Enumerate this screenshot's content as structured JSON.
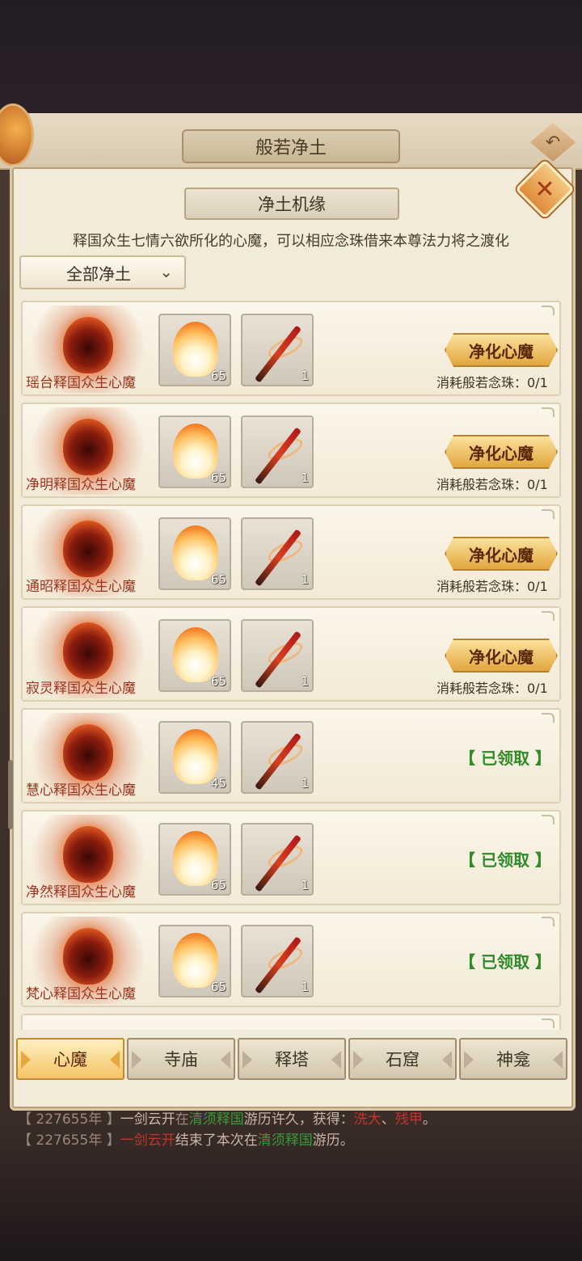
{
  "header": {
    "title": "般若净土"
  },
  "panel": {
    "title": "净土机缘",
    "description": "释国众生七情六欲所化的心魔，可以相应念珠借来本尊法力将之渡化",
    "filter": {
      "selected": "全部净土"
    }
  },
  "rows": [
    {
      "name": "瑶台释国众生心魔",
      "fire_qty": "65",
      "brush_qty": "1",
      "status": "action",
      "button": "净化心魔",
      "cost": "消耗般若念珠：0/1"
    },
    {
      "name": "净明释国众生心魔",
      "fire_qty": "65",
      "brush_qty": "1",
      "status": "action",
      "button": "净化心魔",
      "cost": "消耗般若念珠：0/1"
    },
    {
      "name": "通昭释国众生心魔",
      "fire_qty": "65",
      "brush_qty": "1",
      "status": "action",
      "button": "净化心魔",
      "cost": "消耗般若念珠：0/1"
    },
    {
      "name": "寂灵释国众生心魔",
      "fire_qty": "65",
      "brush_qty": "1",
      "status": "action",
      "button": "净化心魔",
      "cost": "消耗般若念珠：0/1"
    },
    {
      "name": "慧心释国众生心魔",
      "fire_qty": "45",
      "brush_qty": "1",
      "status": "claimed",
      "claimed": "【 已领取 】"
    },
    {
      "name": "净然释国众生心魔",
      "fire_qty": "65",
      "brush_qty": "1",
      "status": "claimed",
      "claimed": "【 已领取 】"
    },
    {
      "name": "梵心释国众生心魔",
      "fire_qty": "65",
      "brush_qty": "1",
      "status": "claimed",
      "claimed": "【 已领取 】"
    }
  ],
  "tabs": [
    "心魔",
    "寺庙",
    "释塔",
    "石窟",
    "神龛"
  ],
  "log": [
    {
      "year": "【 227655年 】",
      "player": "一剑云开",
      "verb": "在",
      "place": "清须释国",
      "rest": "游历许久，获得：",
      "loot1": "洗大",
      "sep": "、",
      "loot2": "残甲",
      "end": "。"
    },
    {
      "year": "【 227655年 】",
      "player": "一剑云开",
      "verb": "结束了本次在",
      "place": "清须释国",
      "rest": "游历。"
    }
  ],
  "colors": {
    "accent": "#e2a63e",
    "claimed": "#2f8a2a",
    "demon_label": "#a0331e"
  }
}
